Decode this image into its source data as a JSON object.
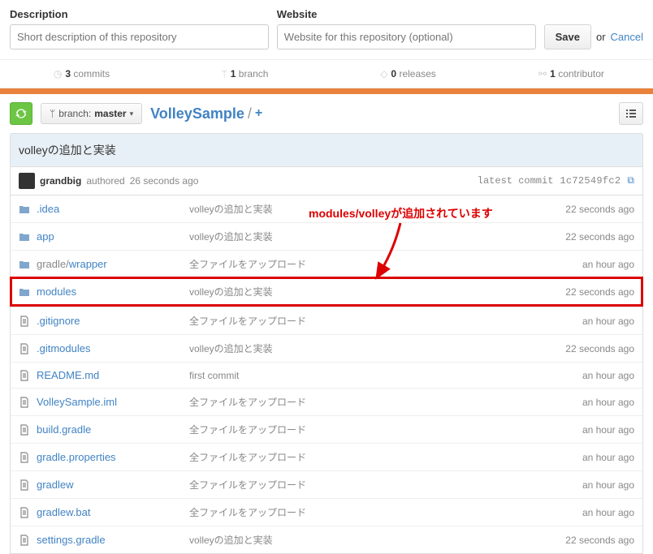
{
  "form": {
    "descLabel": "Description",
    "descPlaceholder": "Short description of this repository",
    "siteLabel": "Website",
    "sitePlaceholder": "Website for this repository (optional)",
    "saveLabel": "Save",
    "orText": "or",
    "cancelText": "Cancel"
  },
  "stats": {
    "commits": {
      "n": "3",
      "label": "commits"
    },
    "branches": {
      "n": "1",
      "label": "branch"
    },
    "releases": {
      "n": "0",
      "label": "releases"
    },
    "contributors": {
      "n": "1",
      "label": "contributor"
    }
  },
  "branch": {
    "prefix": "branch:",
    "name": "master"
  },
  "repoName": "VolleySample",
  "commitMessage": "volleyの追加と実装",
  "author": {
    "name": "grandbig",
    "verb": "authored",
    "when": "26 seconds ago",
    "latestLabel": "latest commit",
    "sha": "1c72549fc2"
  },
  "annotation": {
    "bold": "modules/volley",
    "rest": "が追加されています"
  },
  "files": [
    {
      "type": "folder",
      "name": ".idea",
      "msg": "volleyの追加と実装",
      "time": "22 seconds ago"
    },
    {
      "type": "folder",
      "name": "app",
      "msg": "volleyの追加と実装",
      "time": "22 seconds ago"
    },
    {
      "type": "folder",
      "name": "gradle/",
      "extra": "wrapper",
      "msg": "全ファイルをアップロード",
      "time": "an hour ago"
    },
    {
      "type": "folder",
      "name": "modules",
      "msg": "volleyの追加と実装",
      "time": "22 seconds ago",
      "highlight": true
    },
    {
      "type": "file",
      "name": ".gitignore",
      "msg": "全ファイルをアップロード",
      "time": "an hour ago"
    },
    {
      "type": "file",
      "name": ".gitmodules",
      "msg": "volleyの追加と実装",
      "time": "22 seconds ago"
    },
    {
      "type": "file",
      "name": "README.md",
      "msg": "first commit",
      "time": "an hour ago"
    },
    {
      "type": "file",
      "name": "VolleySample.iml",
      "msg": "全ファイルをアップロード",
      "time": "an hour ago"
    },
    {
      "type": "file",
      "name": "build.gradle",
      "msg": "全ファイルをアップロード",
      "time": "an hour ago"
    },
    {
      "type": "file",
      "name": "gradle.properties",
      "msg": "全ファイルをアップロード",
      "time": "an hour ago"
    },
    {
      "type": "file",
      "name": "gradlew",
      "msg": "全ファイルをアップロード",
      "time": "an hour ago"
    },
    {
      "type": "file",
      "name": "gradlew.bat",
      "msg": "全ファイルをアップロード",
      "time": "an hour ago"
    },
    {
      "type": "file",
      "name": "settings.gradle",
      "msg": "volleyの追加と実装",
      "time": "22 seconds ago"
    }
  ]
}
